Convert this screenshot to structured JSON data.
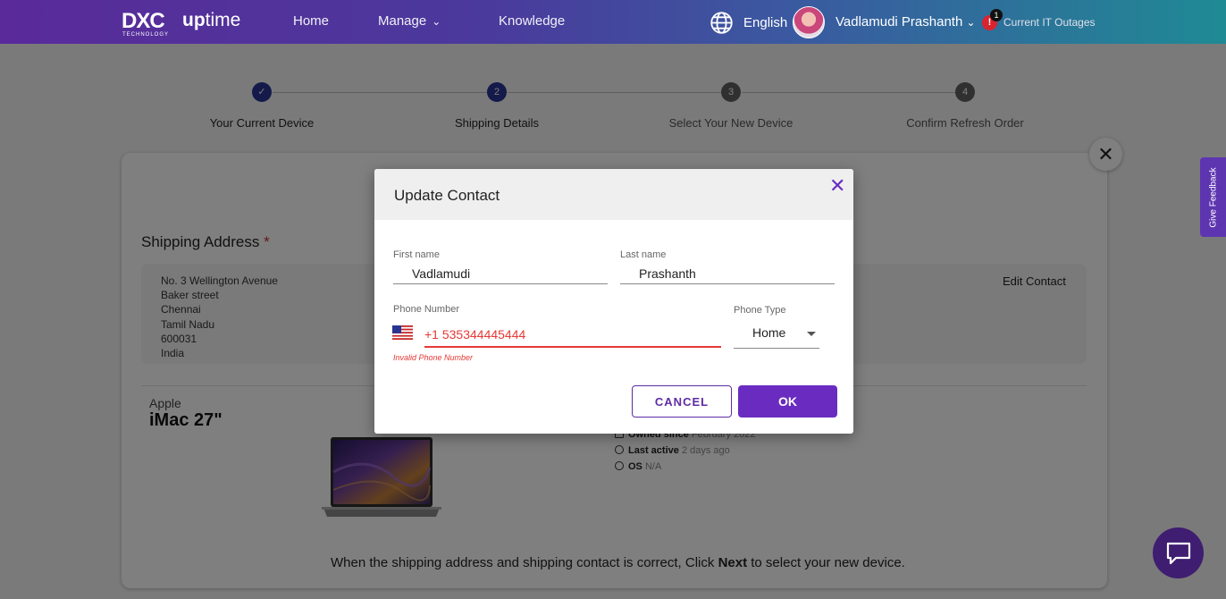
{
  "header": {
    "logo_text": "DXC",
    "logo_subtext": "TECHNOLOGY",
    "product_prefix": "up",
    "product_suffix": "time",
    "nav": [
      {
        "label": "Home"
      },
      {
        "label": "Manage",
        "icon": "chevron-down-icon"
      },
      {
        "label": "Knowledge"
      }
    ],
    "language": "English",
    "user_name": "Vadlamudi Prashanth",
    "alert_count": "1",
    "outages_label": "Current IT Outages",
    "colors": {
      "gradient_start": "#5a2a9a",
      "gradient_end": "#1f8a94"
    }
  },
  "stepper": {
    "steps": [
      {
        "label": "Your Current Device",
        "status": "done",
        "marker": "✓"
      },
      {
        "label": "Shipping Details",
        "status": "active",
        "marker": "2"
      },
      {
        "label": "Select Your New Device",
        "status": "todo",
        "marker": "3"
      },
      {
        "label": "Confirm Refresh Order",
        "status": "todo",
        "marker": "4"
      }
    ]
  },
  "shipping": {
    "title": "Shipping Address",
    "required_mark": "*",
    "address_lines": [
      "No. 3 Wellington Avenue",
      "Baker street",
      "Chennai",
      "Tamil Nadu",
      "600031",
      "India"
    ],
    "edit_contact_label": "Edit Contact"
  },
  "device": {
    "brand": "Apple",
    "model": "iMac 27\"",
    "specs": [
      {
        "label": "Owned since",
        "value": "February 2022",
        "icon": "calendar-icon"
      },
      {
        "label": "Last active",
        "value": "2 days ago",
        "icon": "clock-icon"
      },
      {
        "label": "OS",
        "value": "N/A",
        "icon": "target-icon"
      }
    ]
  },
  "footer_note": {
    "before": "When the shipping address and shipping contact is correct, Click ",
    "emphasis": "Next",
    "after": " to select your new device."
  },
  "feedback_label": "Give Feedback",
  "dialog": {
    "title": "Update Contact",
    "first_name_label": "First name",
    "first_name_value": "Vadlamudi",
    "last_name_label": "Last name",
    "last_name_value": "Prashanth",
    "phone_label": "Phone Number",
    "phone_value": "+1 535344445444",
    "phone_country_icon": "us-flag-icon",
    "phone_error": "Invalid Phone Number",
    "phone_type_label": "Phone Type",
    "phone_type_value": "Home",
    "cancel_label": "CANCEL",
    "ok_label": "OK",
    "colors": {
      "accent": "#6a2cc0",
      "error": "#e53935"
    }
  }
}
